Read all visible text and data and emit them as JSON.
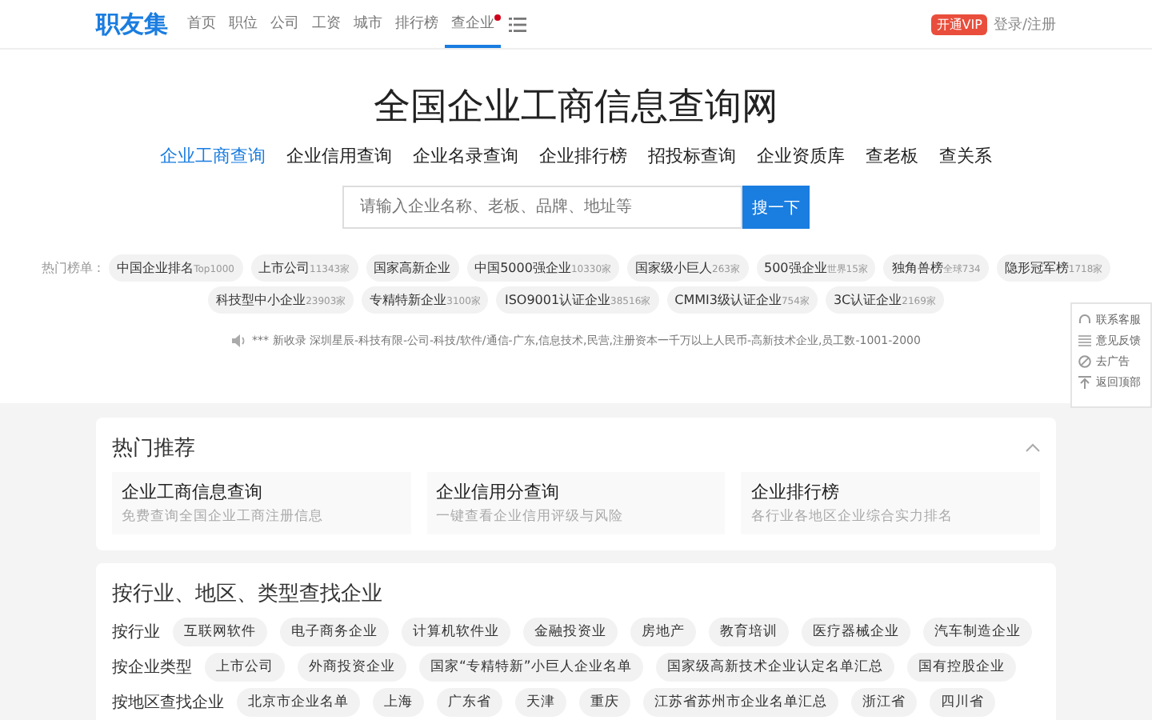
{
  "header": {
    "logo": "职友集",
    "nav": [
      {
        "label": "首页",
        "selected": false
      },
      {
        "label": "职位",
        "selected": false
      },
      {
        "label": "公司",
        "selected": false
      },
      {
        "label": "工资",
        "selected": false
      },
      {
        "label": "城市",
        "selected": false
      },
      {
        "label": "排行榜",
        "selected": false
      },
      {
        "label": "查企业",
        "selected": true,
        "dot": true
      }
    ],
    "vip": "开通VIP",
    "login": "登录/注册"
  },
  "hero": {
    "title": "全国企业工商信息查询网",
    "tabs": [
      {
        "label": "企业工商查询",
        "selected": true
      },
      {
        "label": "企业信用查询",
        "selected": false
      },
      {
        "label": "企业名录查询",
        "selected": false
      },
      {
        "label": "企业排行榜",
        "selected": false
      },
      {
        "label": "招投标查询",
        "selected": false
      },
      {
        "label": "企业资质库",
        "selected": false
      },
      {
        "label": "查老板",
        "selected": false
      },
      {
        "label": "查关系",
        "selected": false
      }
    ],
    "search": {
      "placeholder": "请输入企业名称、老板、品牌、地址等",
      "button": "搜一下"
    },
    "hot_label": "热门榜单 :",
    "hot_rows": [
      [
        {
          "name": "中国企业排名",
          "count": "Top1000"
        },
        {
          "name": "上市公司",
          "count": "11343家"
        },
        {
          "name": "国家高新企业"
        },
        {
          "name": "中国5000强企业",
          "count": "10330家"
        },
        {
          "name": "国家级小巨人",
          "count": "263家"
        },
        {
          "name": "500强企业",
          "count": "世界15家"
        },
        {
          "name": "独角兽榜",
          "count": "全球734"
        },
        {
          "name": "隐形冠军榜",
          "count": "1718家"
        }
      ],
      [
        {
          "name": "科技型中小企业",
          "count": "23903家"
        },
        {
          "name": "专精特新企业",
          "count": "3100家"
        },
        {
          "name": "ISO9001认证企业",
          "count": "38516家"
        },
        {
          "name": "CMMI3级认证企业",
          "count": "754家"
        },
        {
          "name": "3C认证企业",
          "count": "2169家"
        }
      ]
    ],
    "notice": "*** 新收录 深圳星辰-科技有限-公司-科技/软件/通信-广东,信息技术,民营,注册资本一千万以上人民币-高新技术企业,员工数-1001-2000"
  },
  "side_panel": [
    "联系客服",
    "意见反馈",
    "去广告",
    "返回顶部"
  ],
  "recommend": {
    "title": "热门推荐",
    "cards": [
      {
        "title": "企业工商信息查询",
        "desc": "免费查询全国企业工商注册信息"
      },
      {
        "title": "企业信用分查询",
        "desc": "一键查看企业信用评级与风险"
      },
      {
        "title": "企业排行榜",
        "desc": "各行业各地区企业综合实力排名"
      }
    ]
  },
  "browse": {
    "title": "按行业、地区、类型查找企业",
    "rows": [
      {
        "label": "按行业",
        "chips": [
          "互联网软件",
          "电子商务企业",
          "计算机软件业",
          "金融投资业",
          "房地产",
          "教育培训",
          "医疗器械企业",
          "汽车制造企业"
        ]
      },
      {
        "label": "按企业类型",
        "chips": [
          "上市公司",
          "外商投资企业",
          "国家“专精特新”小巨人企业名单",
          "国家级高新技术企业认定名单汇总",
          "国有控股企业"
        ]
      },
      {
        "label": "按地区查找企业",
        "chips": [
          "北京市企业名单",
          "上海",
          "广东省",
          "天津",
          "重庆",
          "江苏省苏州市企业名单汇总",
          "浙江省",
          "四川省"
        ]
      }
    ]
  }
}
